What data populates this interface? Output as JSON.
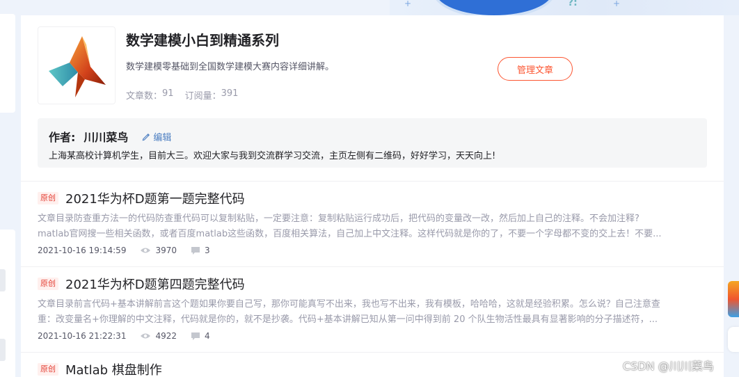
{
  "column": {
    "title": "数学建模小白到精通系列",
    "description": "数学建模零基础到全国数学建模大赛内容详细讲解。",
    "article_count_label": "文章数：",
    "article_count": "91",
    "subscriber_label": "订阅量：",
    "subscriber_count": "391",
    "manage_button": "管理文章",
    "cover_icon": "matlab-logo-icon"
  },
  "author": {
    "label": "作者:",
    "name": "川川菜鸟",
    "edit_label": "编辑",
    "bio": "上海某高校计算机学生，目前大三。欢迎大家与我到交流群学习交流，主页左侧有二维码，好好学习，天天向上!"
  },
  "articles": [
    {
      "tag": "原创",
      "title": "2021华为杯D题第一题完整代码",
      "summary_line1": "文章目录防查重方法一的代码防查重代码可以复制粘贴，一定要注意：复制粘贴运行成功后，把代码的变量改一改，然后加上自己的注释。不会加注释?",
      "summary_line2": "matlab官网搜一些相关函数，或者百度matlab这些函数，百度相关算法，自己加上中文注释。这样代码就是你的了，不要一个字母都不变的交上去！不要...",
      "date": "2021-10-16 19:14:59",
      "views": "3970",
      "comments": "3"
    },
    {
      "tag": "原创",
      "title": "2021华为杯D题第四题完整代码",
      "summary_line1": "文章目录前言代码+基本讲解前言这个题如果你要自己写，那你可能真写不出来，我也写不出来，我有模板，哈哈哈，这就是经验积累。怎么说？自己注意查",
      "summary_line2": "重：改变量名+你理解的中文注释，代码就是你的，就不是抄袭。代码+基本讲解已知从第一问中得到前 20 个队生物活性最具有显著影响的分子描述符，...",
      "date": "2021-10-16 21:22:31",
      "views": "4922",
      "comments": "4"
    },
    {
      "tag": "原创",
      "title": "Matlab 棋盘制作"
    }
  ],
  "watermark": "CSDN @川川菜鸟",
  "colors": {
    "accent": "#fc5531",
    "link": "#4c7ec1",
    "muted": "#999aaa",
    "background": "#eef3fb"
  }
}
